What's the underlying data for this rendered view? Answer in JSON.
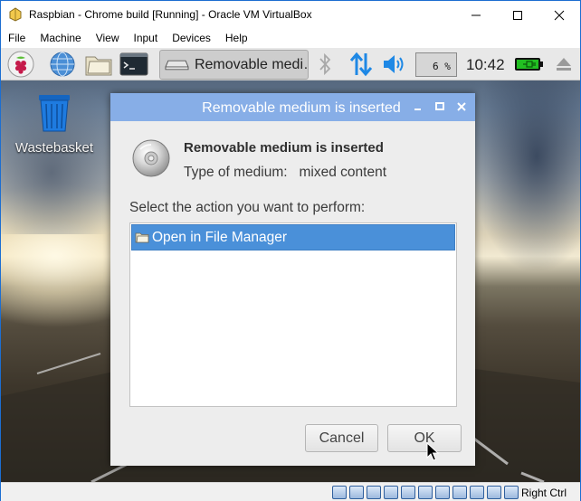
{
  "window": {
    "title": "Raspbian - Chrome build [Running] - Oracle VM VirtualBox",
    "menu": [
      "File",
      "Machine",
      "View",
      "Input",
      "Devices",
      "Help"
    ]
  },
  "panel": {
    "taskbar_item": "Removable medi…",
    "cpu_usage": "6 %",
    "clock": "10:42"
  },
  "desktop": {
    "icon_label": "Wastebasket"
  },
  "dialog": {
    "title": "Removable medium is inserted",
    "heading": "Removable medium is inserted",
    "type_label": "Type of medium:",
    "type_value": "mixed content",
    "prompt": "Select the action you want to perform:",
    "actions": [
      "Open in File Manager"
    ],
    "cancel_label": "Cancel",
    "ok_label": "OK"
  },
  "statusbar": {
    "host_key": "Right Ctrl"
  },
  "colors": {
    "selection": "#4a90d9",
    "dialog_titlebar": "#87aee7",
    "accent_blue": "#1e88e5",
    "battery_green": "#22c022"
  }
}
